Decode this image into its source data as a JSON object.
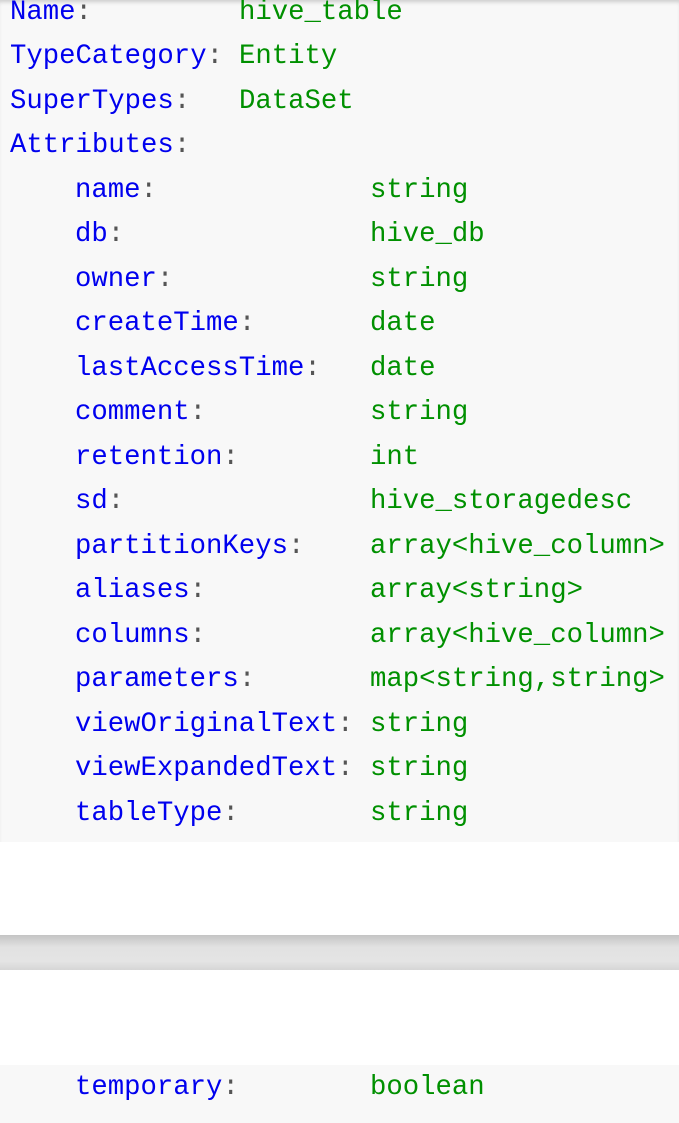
{
  "header": [
    {
      "key": "Name",
      "value": "hive_table"
    },
    {
      "key": "TypeCategory",
      "value": "Entity"
    },
    {
      "key": "SuperTypes",
      "value": "DataSet"
    },
    {
      "key": "Attributes",
      "value": ""
    }
  ],
  "attributes": [
    {
      "key": "name",
      "value": "string"
    },
    {
      "key": "db",
      "value": "hive_db"
    },
    {
      "key": "owner",
      "value": "string"
    },
    {
      "key": "createTime",
      "value": "date"
    },
    {
      "key": "lastAccessTime",
      "value": "date"
    },
    {
      "key": "comment",
      "value": "string"
    },
    {
      "key": "retention",
      "value": "int"
    },
    {
      "key": "sd",
      "value": "hive_storagedesc"
    },
    {
      "key": "partitionKeys",
      "value": "array<hive_column>"
    },
    {
      "key": "aliases",
      "value": "array<string>"
    },
    {
      "key": "columns",
      "value": "array<hive_column>"
    },
    {
      "key": "parameters",
      "value": "map<string,string>"
    },
    {
      "key": "viewOriginalText",
      "value": "string"
    },
    {
      "key": "viewExpandedText",
      "value": "string"
    },
    {
      "key": "tableType",
      "value": "string"
    }
  ],
  "extra_attributes": [
    {
      "key": "temporary",
      "value": "boolean"
    }
  ],
  "colors": {
    "key": "#0000ee",
    "value": "#009000",
    "background": "#f8f8f8"
  }
}
